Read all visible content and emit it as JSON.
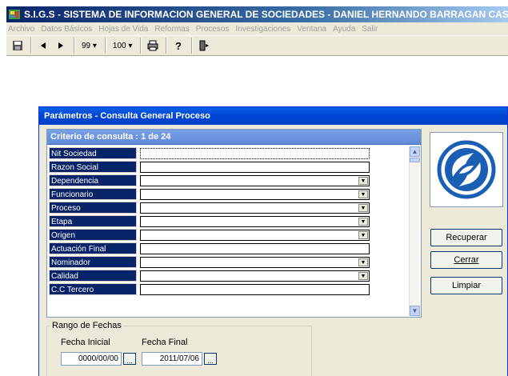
{
  "app": {
    "title": "S.I.G.S   - SISTEMA DE INFORMACION GENERAL DE SOCIEDADES - DANIEL HERNANDO BARRAGAN CASTRO"
  },
  "menu": [
    {
      "label": "Archivo"
    },
    {
      "label": "Datos Básicos"
    },
    {
      "label": "Hojas de Vida"
    },
    {
      "label": "Reformas"
    },
    {
      "label": "Procesos"
    },
    {
      "label": "Investigaciones"
    },
    {
      "label": "Ventana"
    },
    {
      "label": "Ayuda"
    },
    {
      "label": "Salir"
    }
  ],
  "toolbar": {
    "page_combo": "99 ▾",
    "zoom_combo": "100 ▾",
    "icons": [
      "save-icon",
      "prev-icon",
      "next-icon",
      "print-icon",
      "help-icon",
      "exit-icon"
    ]
  },
  "dialog": {
    "title": "Parámetros - Consulta General Proceso",
    "criteria_header": "Criterio de consulta : 1  de  24",
    "fields": [
      {
        "label": "Nit Sociedad",
        "type": "text"
      },
      {
        "label": "Razon Social",
        "type": "text"
      },
      {
        "label": "Dependencia",
        "type": "select"
      },
      {
        "label": "Funcionario",
        "type": "select"
      },
      {
        "label": "Proceso",
        "type": "select"
      },
      {
        "label": "Etapa",
        "type": "select"
      },
      {
        "label": "Origen",
        "type": "select"
      },
      {
        "label": "Actuación Final",
        "type": "text"
      },
      {
        "label": "Nominador",
        "type": "select"
      },
      {
        "label": "Calidad",
        "type": "select"
      },
      {
        "label": "C.C Tercero",
        "type": "text"
      }
    ],
    "buttons": {
      "recuperar": "Recuperar",
      "cerrar": "Cerrar",
      "limpiar": "Limpiar"
    },
    "date_range": {
      "legend": "Rango de Fechas",
      "start_label": "Fecha Inicial",
      "start_value": "0000/00/00",
      "end_label": "Fecha Final",
      "end_value": "2011/07/06",
      "picker_label": "..."
    }
  },
  "colors": {
    "title_bar": "#0a246a",
    "dialog_title": "#0047d4",
    "label_bg": "#0a246a",
    "criteria_header": "#6a94dc",
    "logo": "#1a5fb4"
  }
}
